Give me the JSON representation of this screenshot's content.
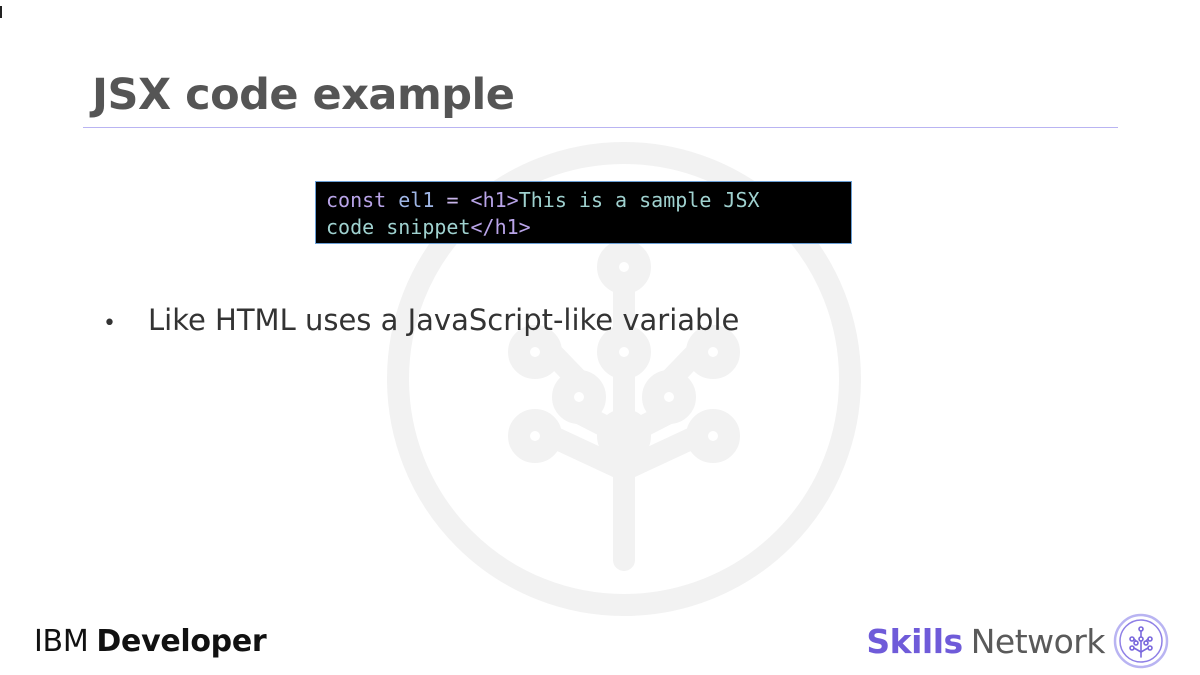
{
  "slide": {
    "title": "JSX code example",
    "code": {
      "line1": {
        "keyword": "const",
        "variable": "el1",
        "operator": "=",
        "open_tag": "<h1>",
        "text": "This is a sample JSX"
      },
      "line2": {
        "text": "code snippet",
        "close_tag": "</h1>"
      }
    },
    "bullets": [
      {
        "marker": "•",
        "text": "Like HTML uses a JavaScript-like variable"
      }
    ]
  },
  "footer": {
    "left_brand_part1": "IBM",
    "left_brand_part2": "Developer",
    "right_brand_part1": "Skills",
    "right_brand_part2": "Network"
  },
  "colors": {
    "title": "#555555",
    "accent_purple": "#6f5bd9",
    "rule": "#b9b4f2",
    "code_bg": "#000000",
    "code_border": "#6a9fd6"
  },
  "icons": {
    "watermark": "skills-network-tree-watermark-icon",
    "logo": "skills-network-logo-icon"
  }
}
